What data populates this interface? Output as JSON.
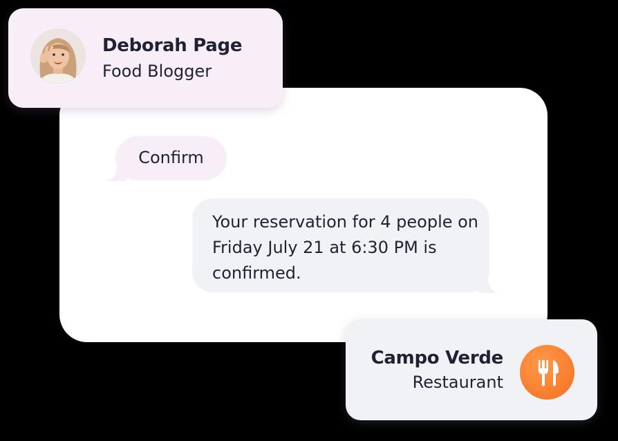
{
  "sender": {
    "name": "Deborah Page",
    "role": "Food Blogger",
    "avatar_icon": "user-avatar"
  },
  "messages": [
    {
      "direction": "incoming",
      "text": "Confirm"
    },
    {
      "direction": "outgoing",
      "text": "Your reservation for 4 people on Friday July 21 at 6:30 PM is confirmed."
    }
  ],
  "business": {
    "name": "Campo Verde",
    "type": "Restaurant",
    "icon": "fork-knife-icon",
    "icon_color": "#f56e20"
  },
  "colors": {
    "sender_card_bg": "#f8eef8",
    "incoming_bubble_bg": "#f8eef8",
    "outgoing_bubble_bg": "#f1f2f5",
    "business_card_bg": "#f1f2f5",
    "chat_window_bg": "#ffffff",
    "text": "#1f2233"
  }
}
